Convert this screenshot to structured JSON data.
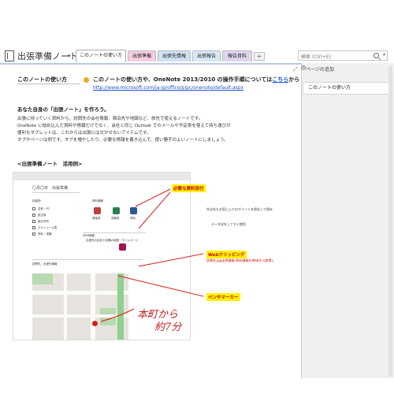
{
  "notebook": {
    "title": "出張準備ノート",
    "caret": "▾"
  },
  "tabs": [
    {
      "label": "このノートの使い方",
      "color": "#ffffff"
    },
    {
      "label": "出張準備",
      "color": "#f6cde0"
    },
    {
      "label": "出張先情報",
      "color": "#cfe2f3"
    },
    {
      "label": "出張報告",
      "color": "#d7e8f7"
    },
    {
      "label": "報告資料",
      "color": "#ded6ee"
    }
  ],
  "tab_add": "+",
  "search": {
    "placeholder": "検索 (Ctrl+E)"
  },
  "expand_icon": "⤢",
  "page": {
    "title": "このノートの使い方",
    "tip_text": "このノートの使い方や、OneNote 2013/2010 の操作手順については",
    "tip_link": "こちら",
    "tip_suffix": "から",
    "tip_url": "http://www.microsoft.com/ja-jp/office/pipc/onenote/default.aspx",
    "intro_heading": "あなた自身の「出張ノート」を作ろう。",
    "intro_lines": [
      "出張に持っていく資料から、訪問先の会社情報、宿泊先や地図など、旅先で使えるノートです。",
      "OneNote に詰め込んだ資料や情報だけでなく、会社と同じ Outlook でのメールや予定表を使えて持ち運びが",
      "便利なタブレットは、これからは出張には欠かせないアイテムです。",
      "タブやページは例です。タブを増やしたり、必要な情報を書き込んで、使い勝手のよいノートにしましょう。"
    ],
    "example_heading": "<出張準備ノート　活用例>"
  },
  "example": {
    "date_title": "〇月〇日　出張準備",
    "section1": "持参物",
    "checklist": [
      "名刺・PC",
      "航空券",
      "宿泊予約",
      "スケジュール表",
      "資料・書類"
    ],
    "section2": "資料情報",
    "file_labels": [
      "提案書",
      "見積書",
      "資料"
    ],
    "section3": "WEB情報",
    "web_text": "出張先の会社や店舗の地図・ホームページ",
    "section4": "訪問先、出張先情報"
  },
  "callouts": {
    "attach": "必要な資料添付",
    "web_clip": "Webクリッピング",
    "web_clip_sub": "訪問先.jpg出張情報-Web情報をWebから取得し",
    "pen": "ペンやマーカー",
    "right_note_1": "外出先もお気に入りのポイントを保存して保存",
    "right_note_2": "データ化をしてすぐ使用"
  },
  "handwriting": {
    "line1": "本町から",
    "line2": "約7分"
  },
  "side_panel": {
    "add_page": "ページの追加",
    "add_icon": "+",
    "pages": [
      "このノートの使い方"
    ]
  },
  "colors": {
    "accent": "#2255cc",
    "callout_yellow": "#fff200",
    "ink_red": "#c21b1b"
  }
}
